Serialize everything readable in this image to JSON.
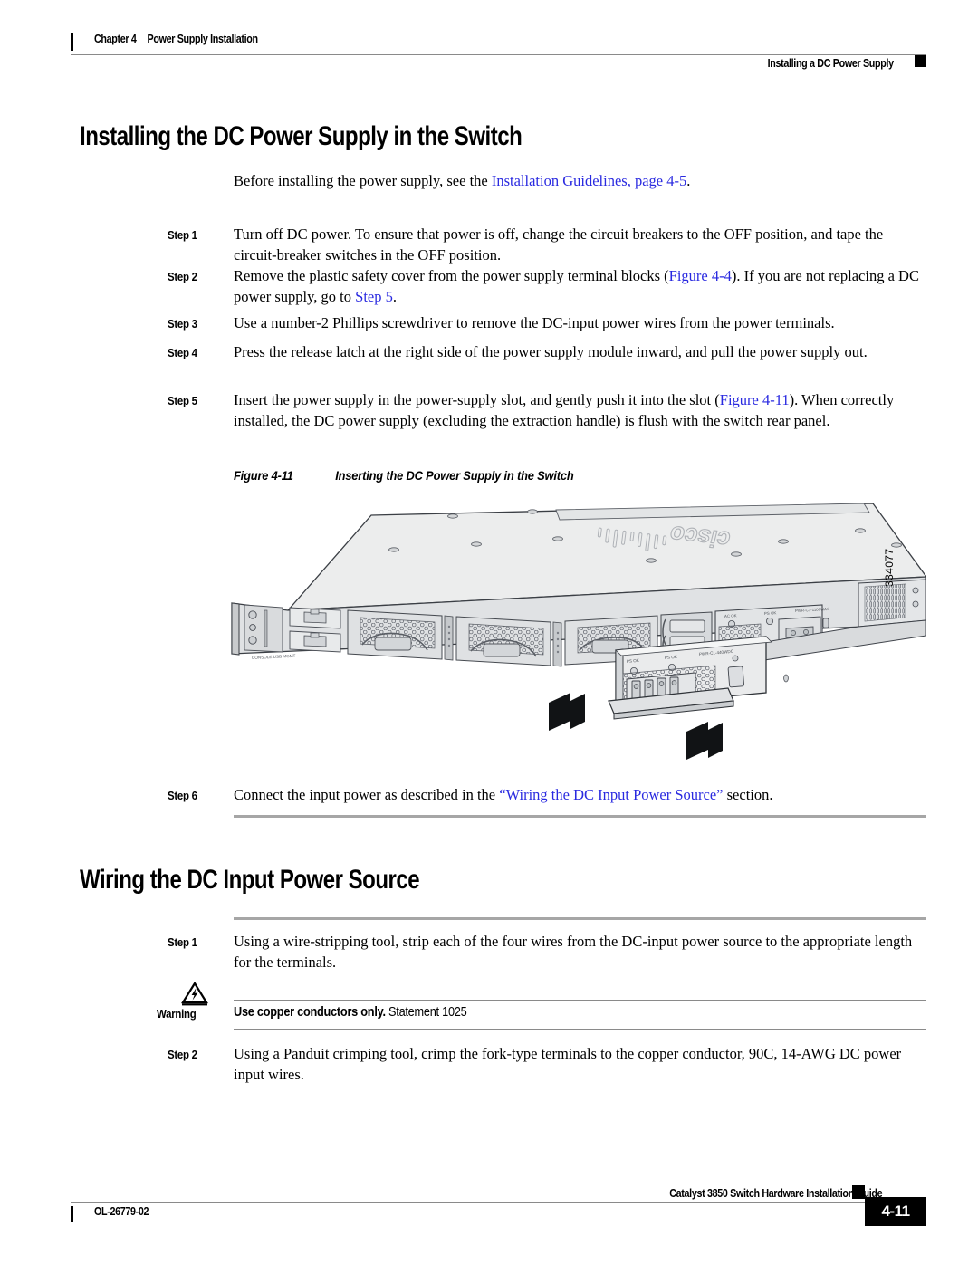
{
  "header": {
    "chapter_number": "Chapter 4",
    "chapter_title": "Power Supply Installation",
    "section_title": "Installing a DC Power Supply"
  },
  "section_install": {
    "heading": "Installing the DC Power Supply in the Switch",
    "intro_prefix": "Before installing the power supply, see the ",
    "intro_link": "Installation Guidelines, page 4-5",
    "intro_suffix": ".",
    "steps": [
      {
        "label": "Step 1",
        "text": "Turn off DC power. To ensure that power is off, change the circuit breakers to the OFF position, and tape the circuit-breaker switches in the OFF position."
      },
      {
        "label": "Step 2",
        "text_a": "Remove the plastic safety cover from the power supply terminal blocks (",
        "link_a": "Figure 4-4",
        "text_b": "). If you are not replacing a DC power supply, go to ",
        "link_b": "Step 5",
        "text_c": "."
      },
      {
        "label": "Step 3",
        "text": "Use a number-2 Phillips screwdriver to remove the DC-input power wires from the power terminals."
      },
      {
        "label": "Step 4",
        "text": "Press the release latch at the right side of the power supply module inward, and pull the power supply out."
      },
      {
        "label": "Step 5",
        "text_a": "Insert the power supply in the power-supply slot, and gently push it into the slot (",
        "link_a": "Figure 4-11",
        "text_b": "). When correctly installed, the DC power supply (excluding the extraction handle) is flush with the switch rear panel."
      },
      {
        "label": "Step 6",
        "text_a": "Connect the input power as described in the ",
        "link_a": "“Wiring the DC Input Power Source”",
        "text_b": " section."
      }
    ]
  },
  "figure": {
    "number": "Figure 4-11",
    "title": "Inserting the DC Power Supply in the Switch",
    "illustration_id": "334077",
    "alt": "Line drawing of a Catalyst 3850 switch rear panel with a DC power supply module being inserted into the power-supply slot, indicated by two black arrows.",
    "chassis_logo": "cisco",
    "module_labels": [
      "AC OK",
      "PS OK",
      "PWR-C1-1100WAC",
      "PWR-C1-440WDC"
    ]
  },
  "section_wiring": {
    "heading": "Wiring the DC Input Power Source",
    "steps": [
      {
        "label": "Step 1",
        "text": "Using a wire-stripping tool, strip each of the four wires from the DC-input power source to the appropriate length for the terminals."
      },
      {
        "label": "Step 2",
        "text": "Using a Panduit crimping tool, crimp the fork-type terminals to the copper conductor, 90C, 14-AWG DC power input wires."
      }
    ],
    "warning": {
      "label": "Warning",
      "bold_text": "Use copper conductors only.",
      "statement": " Statement 1025"
    }
  },
  "footer": {
    "guide_title": "Catalyst 3850 Switch Hardware Installation Guide",
    "doc_id": "OL-26779-02",
    "page_number": "4-11"
  },
  "colors": {
    "link": "#2a2ae0",
    "rule_gray": "#a6a6a6",
    "rule_thin": "#8a8a8a",
    "text": "#000000"
  }
}
